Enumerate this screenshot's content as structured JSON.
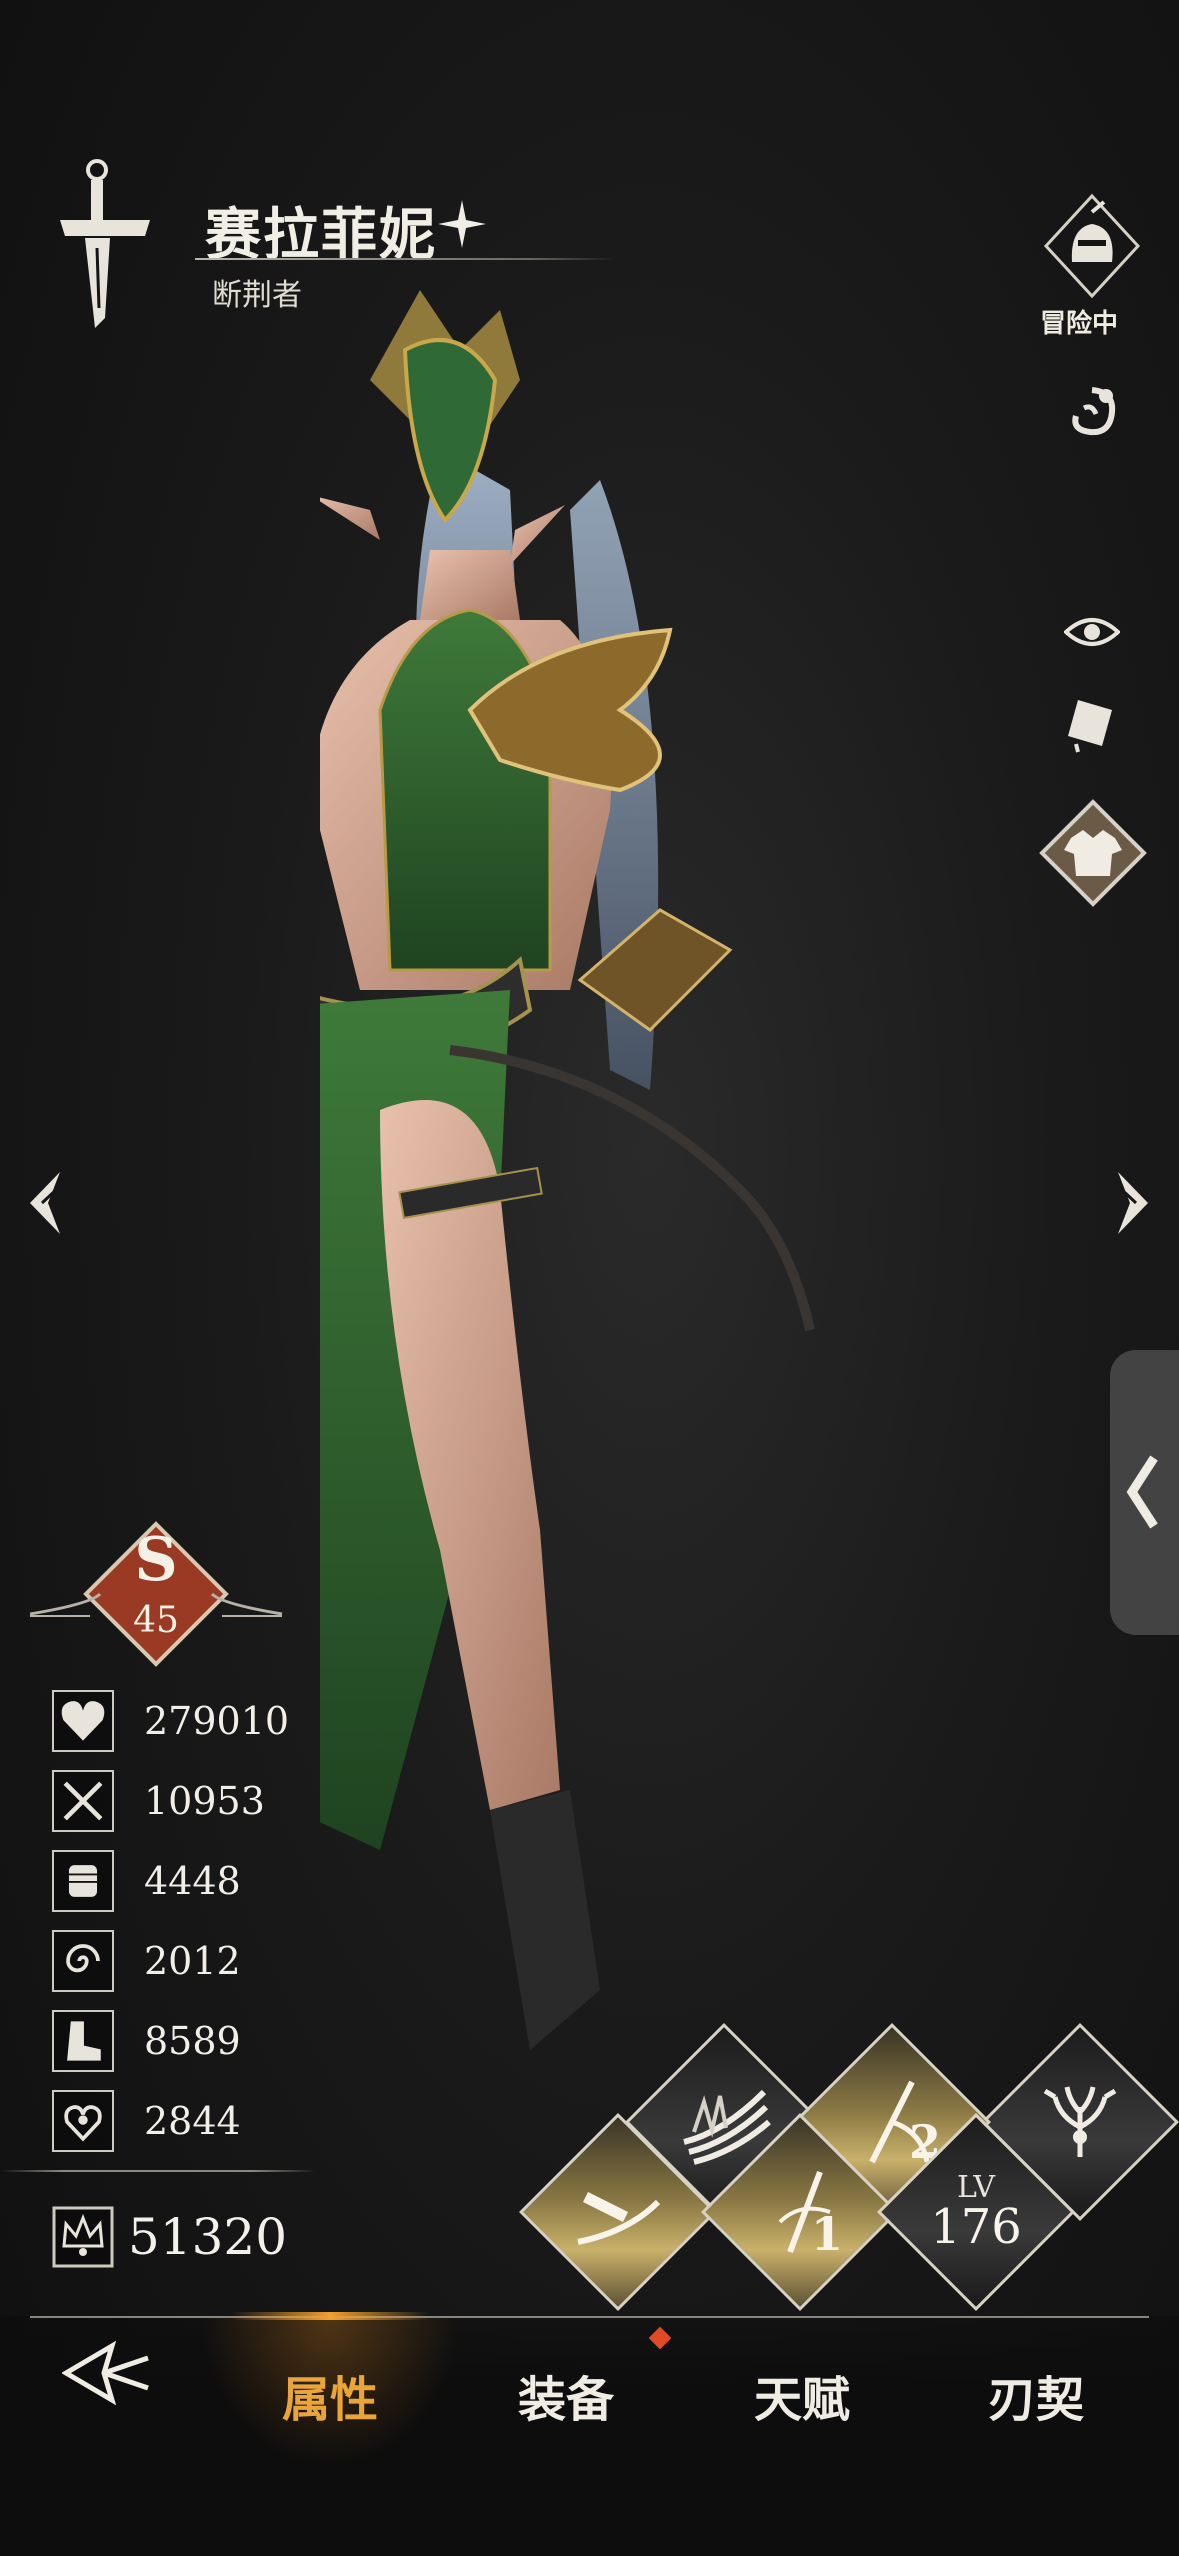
{
  "character": {
    "name": "赛拉菲妮",
    "title": "断荆者",
    "status": "冒险中"
  },
  "rank": {
    "grade": "S",
    "level": "45"
  },
  "stats": [
    {
      "icon": "heart-icon",
      "value": "279010"
    },
    {
      "icon": "crossed-swords-icon",
      "value": "10953"
    },
    {
      "icon": "fist-icon",
      "value": "4448"
    },
    {
      "icon": "swirl-icon",
      "value": "2012"
    },
    {
      "icon": "boot-icon",
      "value": "8589"
    },
    {
      "icon": "heart-hand-icon",
      "value": "2844"
    }
  ],
  "power": {
    "icon": "crown-icon",
    "value": "51320"
  },
  "skills": {
    "skill_1": "1",
    "skill_2": "2",
    "level_label": "LV",
    "level_value": "176"
  },
  "nav": {
    "tabs": [
      "属性",
      "装备",
      "天赋",
      "刃契"
    ],
    "active": "属性"
  },
  "colors": {
    "accent": "#e9a53a",
    "rank_badge": "#9b3a24",
    "skill_gold": "#c9b16b",
    "notify": "#e04a25"
  }
}
